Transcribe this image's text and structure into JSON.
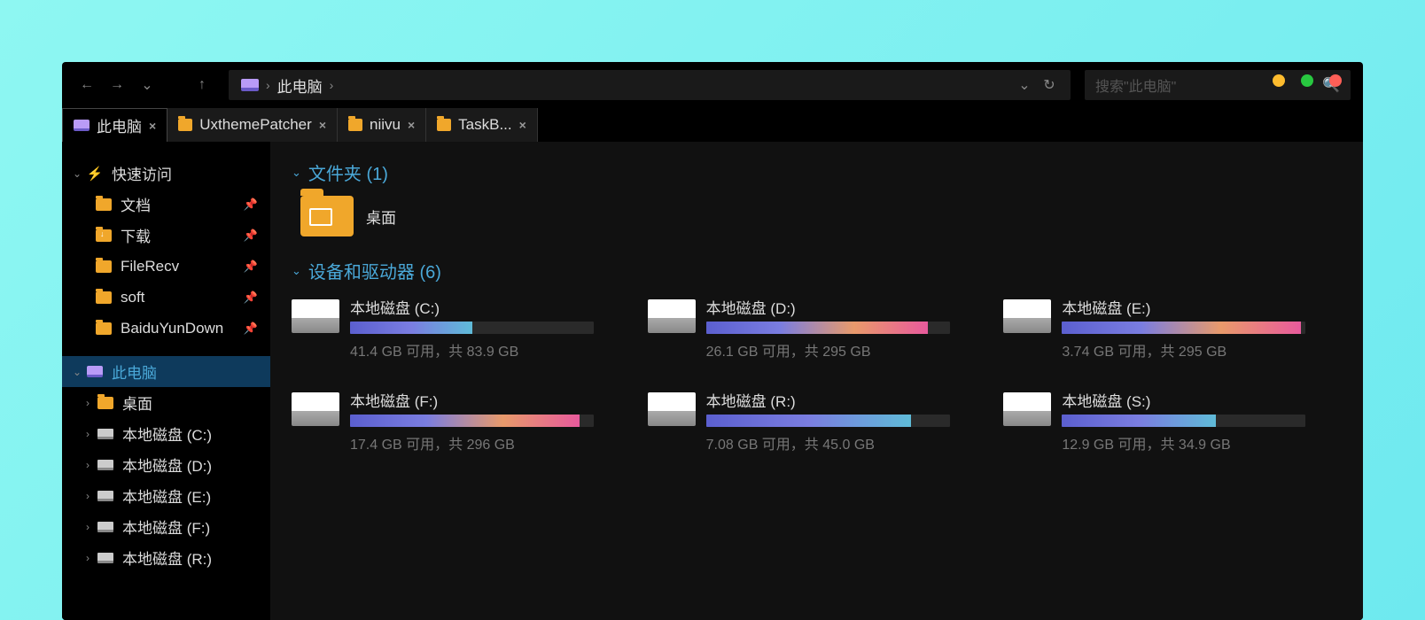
{
  "window_controls": {
    "min": "min",
    "max": "max",
    "close": "close"
  },
  "toolbar": {
    "back": "←",
    "forward": "→",
    "recent_dd": "⌄",
    "up": "↑",
    "breadcrumb": {
      "root_icon": "pc",
      "root": "此电脑",
      "sep": "›"
    },
    "addr_dd": "⌄",
    "refresh": "↻"
  },
  "search": {
    "placeholder": "搜索\"此电脑\"",
    "icon": "search"
  },
  "tabs": [
    {
      "icon": "pc",
      "label": "此电脑",
      "closable": true,
      "active": true
    },
    {
      "icon": "folder",
      "label": "UxthemePatcher",
      "closable": true,
      "active": false
    },
    {
      "icon": "folder",
      "label": "niivu",
      "closable": true,
      "active": false
    },
    {
      "icon": "folder",
      "label": "TaskB...",
      "closable": true,
      "active": false
    }
  ],
  "sidebar": {
    "quick_access": {
      "label": "快速访问",
      "items": [
        {
          "label": "文档",
          "pinned": true,
          "icon": "folder"
        },
        {
          "label": "下载",
          "pinned": true,
          "icon": "folder-dl"
        },
        {
          "label": "FileRecv",
          "pinned": true,
          "icon": "folder"
        },
        {
          "label": "soft",
          "pinned": true,
          "icon": "folder"
        },
        {
          "label": "BaiduYunDown",
          "pinned": true,
          "icon": "folder"
        }
      ]
    },
    "this_pc": {
      "label": "此电脑",
      "selected": true,
      "children": [
        {
          "label": "桌面",
          "icon": "folder",
          "expandable": true
        },
        {
          "label": "本地磁盘 (C:)",
          "icon": "drive",
          "expandable": true
        },
        {
          "label": "本地磁盘 (D:)",
          "icon": "drive",
          "expandable": true
        },
        {
          "label": "本地磁盘 (E:)",
          "icon": "drive",
          "expandable": true
        },
        {
          "label": "本地磁盘 (F:)",
          "icon": "drive",
          "expandable": true
        },
        {
          "label": "本地磁盘 (R:)",
          "icon": "drive",
          "expandable": true
        }
      ]
    }
  },
  "main": {
    "group_folders": {
      "title": "文件夹 (1)",
      "items": [
        {
          "label": "桌面"
        }
      ]
    },
    "group_drives": {
      "title": "设备和驱动器 (6)",
      "items": [
        {
          "name": "本地磁盘 (C:)",
          "free": 41.4,
          "total": 83.9,
          "free_label": "41.4 GB 可用，共 83.9 GB",
          "fill_pct": 50,
          "fill_class": "fill-1"
        },
        {
          "name": "本地磁盘 (D:)",
          "free": 26.1,
          "total": 295,
          "free_label": "26.1 GB 可用，共 295 GB",
          "fill_pct": 91,
          "fill_class": "fill-2"
        },
        {
          "name": "本地磁盘 (E:)",
          "free": 3.74,
          "total": 295,
          "free_label": "3.74 GB 可用，共 295 GB",
          "fill_pct": 98,
          "fill_class": "fill-3"
        },
        {
          "name": "本地磁盘 (F:)",
          "free": 17.4,
          "total": 296,
          "free_label": "17.4 GB 可用，共 296 GB",
          "fill_pct": 94,
          "fill_class": "fill-3"
        },
        {
          "name": "本地磁盘 (R:)",
          "free": 7.08,
          "total": 45.0,
          "free_label": "7.08 GB 可用，共 45.0 GB",
          "fill_pct": 84,
          "fill_class": "fill-1"
        },
        {
          "name": "本地磁盘 (S:)",
          "free": 12.9,
          "total": 34.9,
          "free_label": "12.9 GB 可用，共 34.9 GB",
          "fill_pct": 63,
          "fill_class": "fill-1"
        }
      ]
    }
  }
}
